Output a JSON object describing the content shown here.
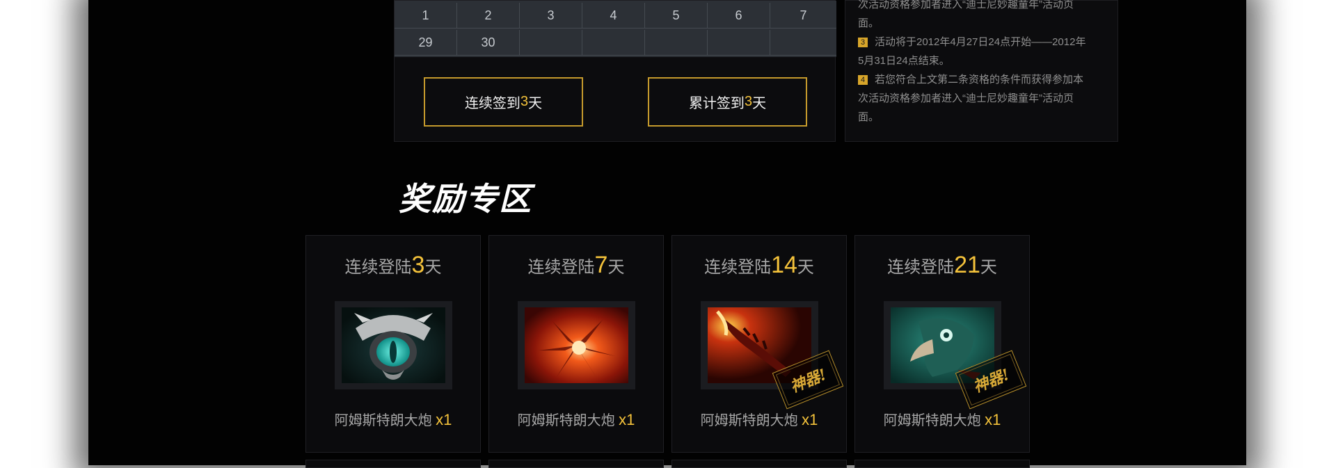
{
  "calendar": {
    "row1": [
      "1",
      "2",
      "3",
      "4",
      "5",
      "6",
      "7"
    ],
    "row2": [
      "29",
      "30",
      "",
      "",
      "",
      "",
      ""
    ]
  },
  "sign_buttons": [
    {
      "prefix": "连续签到",
      "days": "3",
      "suffix": "天"
    },
    {
      "prefix": "累计签到",
      "days": "3",
      "suffix": "天"
    }
  ],
  "rules": {
    "line_top_a": "次活动资格参加者进入“迪士尼妙趣童年”活动页",
    "line_top_b": "面。",
    "item3_index": "3",
    "item3_a": "活动将于2012年4月27日24点开始——2012年",
    "item3_b": "5月31日24点结束。",
    "item4_index": "4",
    "item4_a": "若您符合上文第二条资格的条件而获得参加本",
    "item4_b": "次活动资格参加者进入“迪士尼妙趣童年”活动页",
    "item4_c": "面。"
  },
  "section_title": "奖励专区",
  "rewards": [
    {
      "prefix": "连续登陆",
      "days": "3",
      "suffix": "天",
      "item": "阿姆斯特朗大炮",
      "qty": "x1",
      "stamp": "",
      "icon": "eye-shield-icon"
    },
    {
      "prefix": "连续登陆",
      "days": "7",
      "suffix": "天",
      "item": "阿姆斯特朗大炮",
      "qty": "x1",
      "stamp": "",
      "icon": "flame-flower-icon"
    },
    {
      "prefix": "连续登陆",
      "days": "14",
      "suffix": "天",
      "item": "阿姆斯特朗大炮",
      "qty": "x1",
      "stamp": "神器!",
      "icon": "fire-sword-icon"
    },
    {
      "prefix": "连续登陆",
      "days": "21",
      "suffix": "天",
      "item": "阿姆斯特朗大炮",
      "qty": "x1",
      "stamp": "神器!",
      "icon": "bird-mask-icon"
    }
  ],
  "colors": {
    "accent": "#f5c33b",
    "panel": "#0c0c0e",
    "calendar": "#2c3036"
  }
}
